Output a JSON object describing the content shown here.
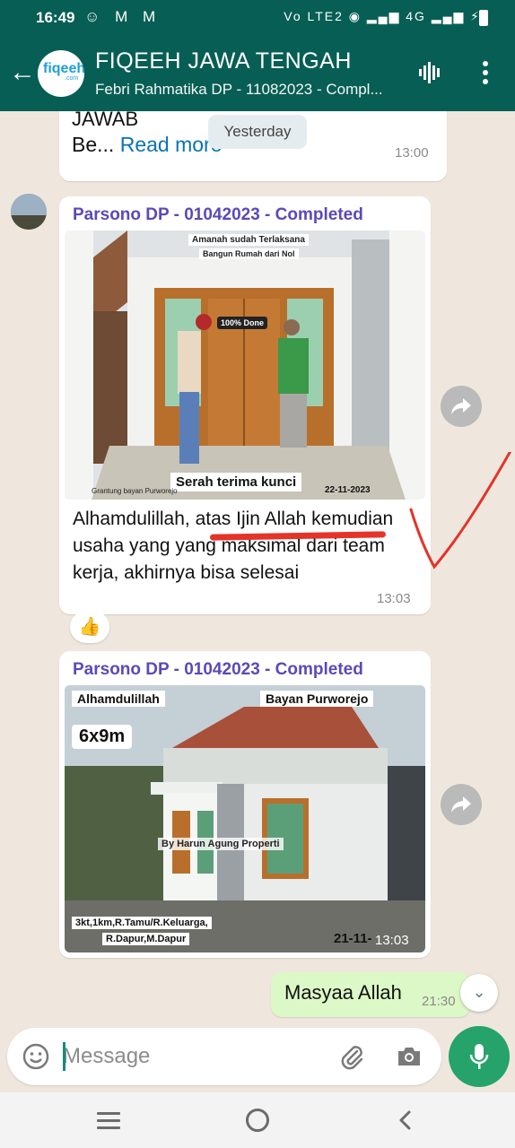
{
  "status_bar": {
    "time": "16:49",
    "left_icons": "☺ M M",
    "right_icons": "Vo LTE2 ◉ ▂▄▆ 4G ▂▄▆ ⚡"
  },
  "header": {
    "title": "FIQEEH JAWA TENGAH",
    "subtitle": "Febri Rahmatika DP - 11082023 - Compl...",
    "avatar_brand": "fiqeeh",
    "avatar_brand_sub": ".com"
  },
  "date_chip": "Yesterday",
  "messages": {
    "prev": {
      "clipped_text": "JAWAB",
      "text_prefix": "Be...",
      "read_more": "Read more",
      "time": "13:00"
    },
    "msg1": {
      "sender": "Parsono DP - 01042023 - Completed",
      "image_caption_top1": "Amanah sudah Terlaksana",
      "image_caption_top2": "Bangun Rumah dari Nol",
      "image_badge": "100% Done",
      "image_caption_bottom": "Serah terima kunci",
      "image_caption_location": "Grantung bayan Purworejo",
      "image_caption_date": "22-11-2023",
      "text_a": "Alhamdulillah, ",
      "text_b": "atas Ijin Allah",
      "text_c": " kemudian usaha yang yang maksimal dari team kerja, akhirnya bisa selesai",
      "time": "13:03",
      "reaction": "👍"
    },
    "msg2": {
      "sender": "Parsono DP - 01042023 - Completed",
      "image_label_left": "Alhamdulillah",
      "image_label_right": "Bayan Purworejo",
      "image_size": "6x9m",
      "image_watermark": "By Harun Agung Properti",
      "image_spec_1": "3kt,1km,R.Tamu/R.Keluarga,",
      "image_spec_2": "R.Dapur,M.Dapur",
      "image_date": "21-11-",
      "time": "13:03"
    },
    "msg3": {
      "text": "Masyaa Allah",
      "time": "21:30"
    }
  },
  "composer": {
    "placeholder": "Message"
  },
  "colors": {
    "header_bg": "#075e54",
    "accent_green": "#25a36b",
    "sender_name": "#5b49b7",
    "link": "#0a73b7",
    "outgoing_bubble": "#dcf8c6",
    "annotation_red": "#e5332a"
  },
  "icons": [
    "back-arrow-icon",
    "voice-chat-icon",
    "more-vert-icon",
    "share-forward-icon",
    "emoji-icon",
    "attach-icon",
    "camera-icon",
    "mic-icon",
    "chevron-double-down-icon"
  ]
}
